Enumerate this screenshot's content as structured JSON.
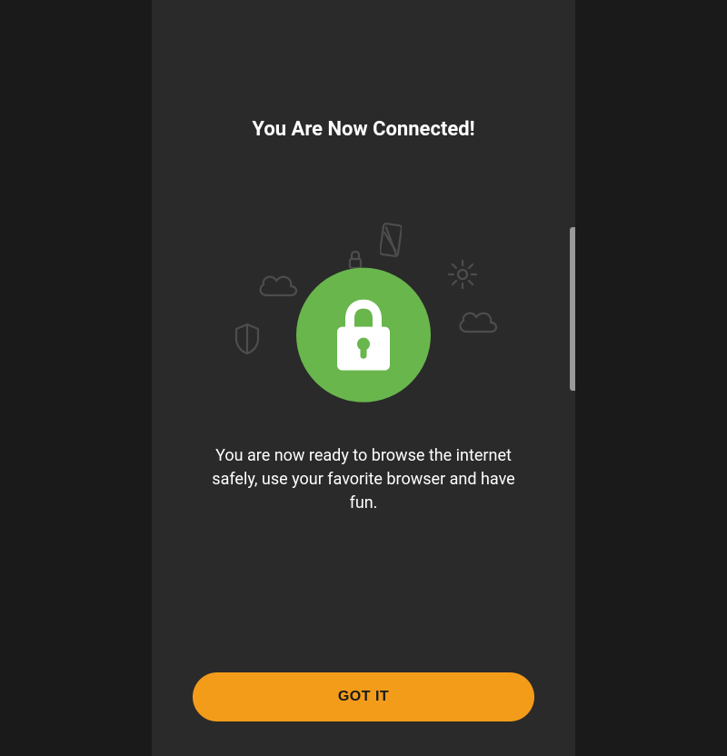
{
  "screen": {
    "title": "You Are Now Connected!",
    "subtitle": "You are now ready to browse the internet safely, use your favorite browser and have fun.",
    "cta_label": "GOT IT"
  },
  "colors": {
    "background": "#2a2a2a",
    "accent_success": "#69b64c",
    "accent_button": "#f39c1a",
    "text": "#ffffff",
    "doodle": "#4d4d4d"
  },
  "icons": {
    "main": "lock-icon",
    "doodles": [
      "cloud-icon",
      "shield-icon",
      "lock-small-icon",
      "phone-icon",
      "gear-icon",
      "cloud-icon"
    ]
  }
}
